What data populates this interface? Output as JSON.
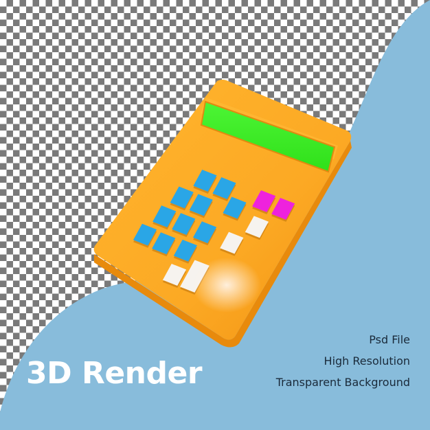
{
  "headline": "3D Render",
  "features": [
    "Psd File",
    "High Resolution",
    "Transparent Background"
  ],
  "illustration": {
    "subject": "calculator",
    "background": "transparent-checkerboard",
    "colors": {
      "blob": "#88bcdb",
      "body": "#fca924",
      "screen": "#3aee22",
      "number_keys": "#2aa6e6",
      "function_keys": "#ee22dd",
      "operator_keys": "#f6f3ef",
      "text_dark": "#1a2a3a",
      "text_light": "#ffffff"
    },
    "keys": {
      "number_key_count": 11,
      "function_key_count": 2,
      "operator_key_count": 4
    }
  }
}
